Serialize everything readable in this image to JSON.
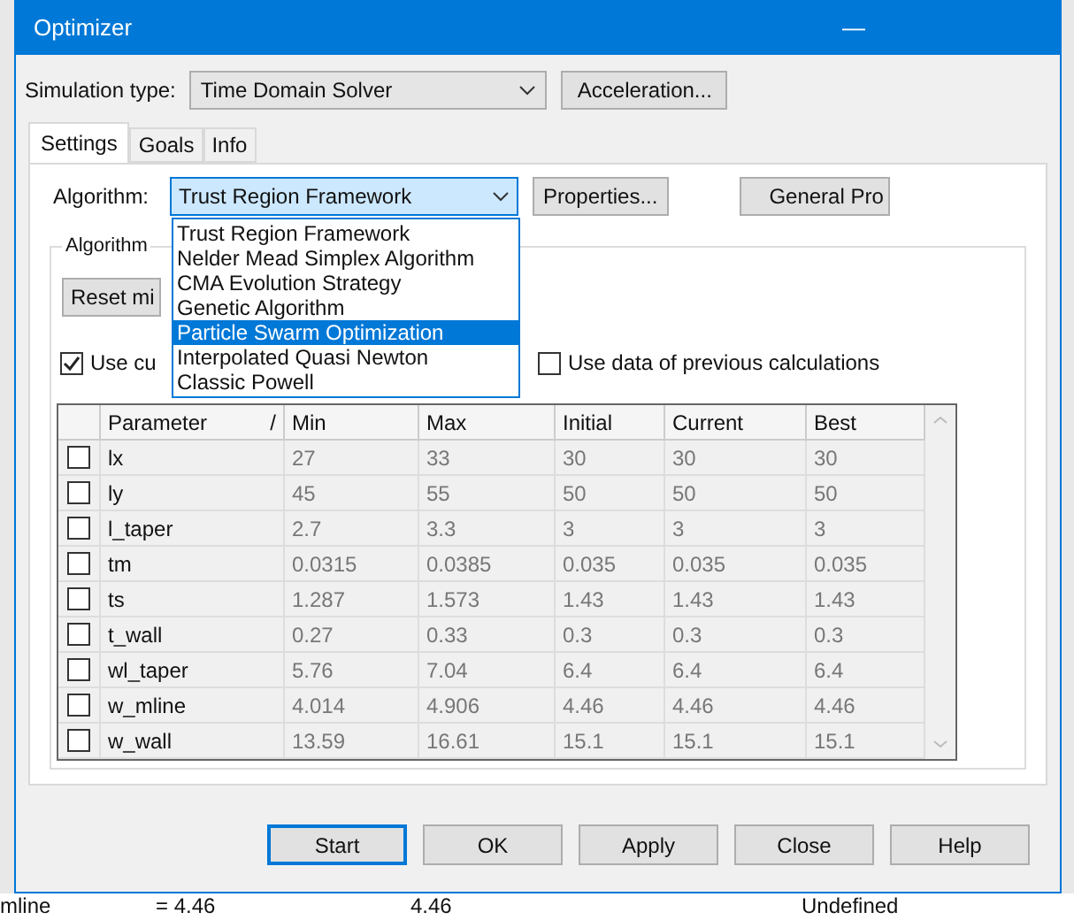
{
  "window": {
    "title": "Optimizer",
    "minimize": "—"
  },
  "simulation_type": {
    "label": "Simulation type:",
    "value": "Time Domain Solver",
    "button": "Acceleration..."
  },
  "tabs": [
    {
      "label": "Settings",
      "selected": true
    },
    {
      "label": "Goals",
      "selected": false
    },
    {
      "label": "Info",
      "selected": false
    }
  ],
  "algorithm": {
    "label": "Algorithm:",
    "value": "Trust Region Framework",
    "properties_button": "Properties...",
    "general_button": "General Pro",
    "options": [
      {
        "label": "Trust Region Framework",
        "highlighted": false
      },
      {
        "label": "Nelder Mead Simplex Algorithm",
        "highlighted": false
      },
      {
        "label": "CMA Evolution Strategy",
        "highlighted": false
      },
      {
        "label": "Genetic Algorithm",
        "highlighted": false
      },
      {
        "label": "Particle Swarm Optimization",
        "highlighted": true
      },
      {
        "label": "Interpolated Quasi Newton",
        "highlighted": false
      },
      {
        "label": "Classic Powell",
        "highlighted": false
      }
    ]
  },
  "group_label": "Algorithm",
  "reset_button": "Reset mi",
  "use_current": {
    "label": "Use cu",
    "checked": true
  },
  "use_previous": {
    "label": "Use data of previous calculations",
    "checked": false
  },
  "table": {
    "columns": [
      "Parameter",
      "Min",
      "Max",
      "Initial",
      "Current",
      "Best"
    ],
    "sort_mark": "/",
    "rows": [
      {
        "checked": false,
        "cells": [
          "lx",
          "27",
          "33",
          "30",
          "30",
          "30"
        ]
      },
      {
        "checked": false,
        "cells": [
          "ly",
          "45",
          "55",
          "50",
          "50",
          "50"
        ]
      },
      {
        "checked": false,
        "cells": [
          "l_taper",
          "2.7",
          "3.3",
          "3",
          "3",
          "3"
        ]
      },
      {
        "checked": false,
        "cells": [
          "tm",
          "0.0315",
          "0.0385",
          "0.035",
          "0.035",
          "0.035"
        ]
      },
      {
        "checked": false,
        "cells": [
          "ts",
          "1.287",
          "1.573",
          "1.43",
          "1.43",
          "1.43"
        ]
      },
      {
        "checked": false,
        "cells": [
          "t_wall",
          "0.27",
          "0.33",
          "0.3",
          "0.3",
          "0.3"
        ]
      },
      {
        "checked": false,
        "cells": [
          "wl_taper",
          "5.76",
          "7.04",
          "6.4",
          "6.4",
          "6.4"
        ]
      },
      {
        "checked": false,
        "cells": [
          "w_mline",
          "4.014",
          "4.906",
          "4.46",
          "4.46",
          "4.46"
        ]
      },
      {
        "checked": false,
        "cells": [
          "w_wall",
          "13.59",
          "16.61",
          "15.1",
          "15.1",
          "15.1"
        ]
      }
    ]
  },
  "buttons": [
    {
      "label": "Start",
      "selected": true
    },
    {
      "label": "OK",
      "selected": false
    },
    {
      "label": "Apply",
      "selected": false
    },
    {
      "label": "Close",
      "selected": false
    },
    {
      "label": "Help",
      "selected": false
    }
  ],
  "background_row": [
    "mline",
    "= 4.46",
    "4.46",
    "Undefined"
  ]
}
